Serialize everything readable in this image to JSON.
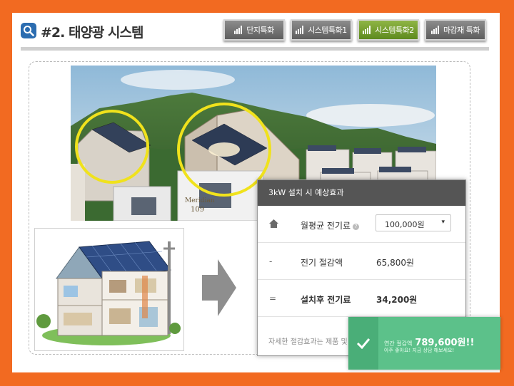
{
  "header": {
    "title": "#2. 태양광 시스템",
    "search_icon": "search-icon"
  },
  "tabs": [
    {
      "label": "단지특화",
      "icon": "bar-chart-icon",
      "active": false
    },
    {
      "label": "시스템특화1",
      "icon": "bar-chart-icon",
      "active": false
    },
    {
      "label": "시스템특화2",
      "icon": "bar-chart-icon",
      "active": true
    },
    {
      "label": "마감재 특화",
      "icon": "bar-chart-icon",
      "active": false
    }
  ],
  "photo": {
    "building_sign_1": "Meridian",
    "building_sign_2": "109"
  },
  "calculator": {
    "header": "3kW 설치 시 예상효과",
    "rows": {
      "monthly": {
        "icon": "home-icon",
        "label": "월평균 전기료",
        "value": "100,000원"
      },
      "savings": {
        "icon": "-",
        "label": "전기 절감액",
        "value": "65,800원"
      },
      "after": {
        "icon": "=",
        "label": "설치후 전기료",
        "value": "34,200원"
      }
    },
    "footer": "자세한 절감효과는 제품 및 환"
  },
  "toast": {
    "line1_prefix": "연간 절감액",
    "amount": "789,600원!!",
    "line2": "아주 좋아요! 지금 상담 해보세요!",
    "icon": "check-icon"
  },
  "colors": {
    "border_orange": "#f26a21",
    "tab_gray": "#6e6e6e",
    "tab_active_green": "#6f9b2c",
    "toast_green": "#5cc18a"
  }
}
